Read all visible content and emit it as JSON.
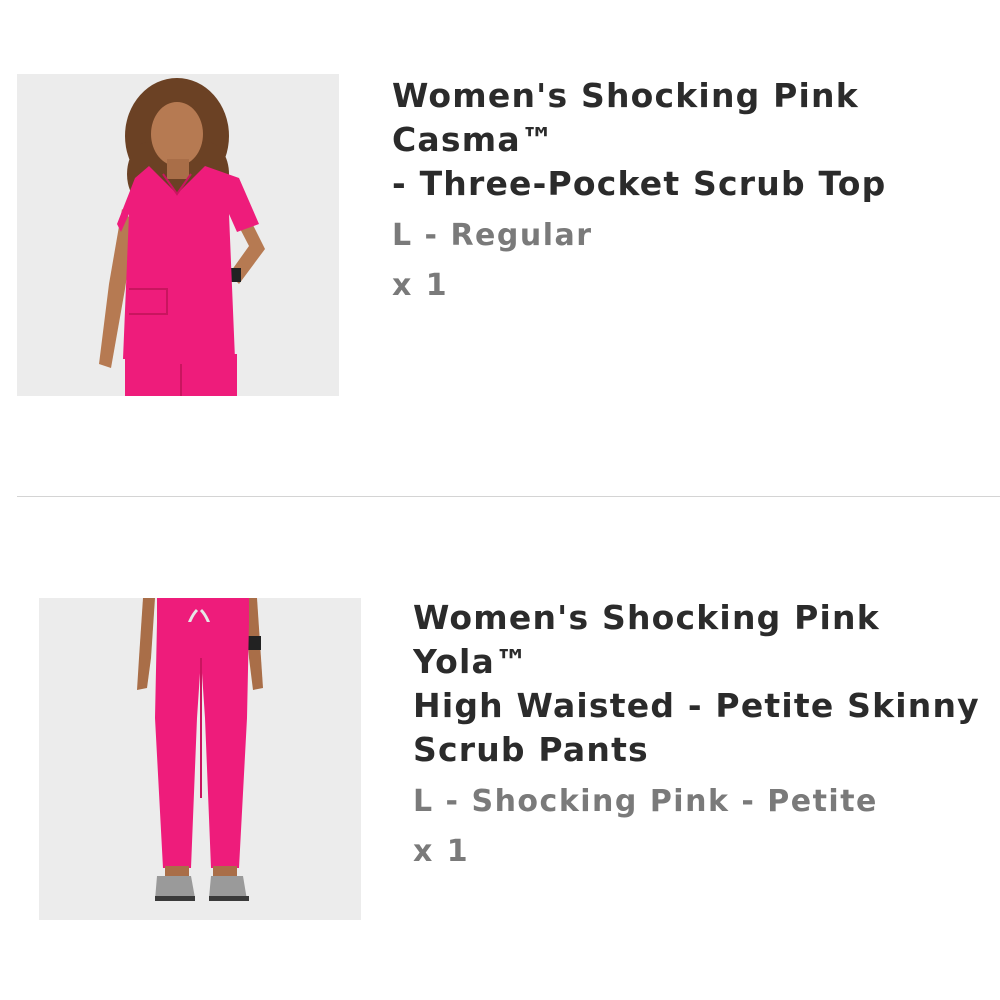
{
  "cart": {
    "items": [
      {
        "title": "Women's Shocking Pink Casma™\n- Three-Pocket Scrub Top",
        "variant": "L - Regular",
        "quantity": "x 1",
        "image_subject": "scrub-top-photo"
      },
      {
        "title": "Women's Shocking Pink Yola™\nHigh Waisted - Petite Skinny\nScrub Pants",
        "variant": "L - Shocking Pink - Petite",
        "quantity": "x 1",
        "image_subject": "scrub-pants-photo"
      }
    ]
  },
  "colors": {
    "product_pink": "#ee1c7b",
    "title_text": "#2b2b2b",
    "meta_text": "#7a7a7a",
    "image_bg": "#ececec",
    "divider": "#d4d4d4"
  }
}
